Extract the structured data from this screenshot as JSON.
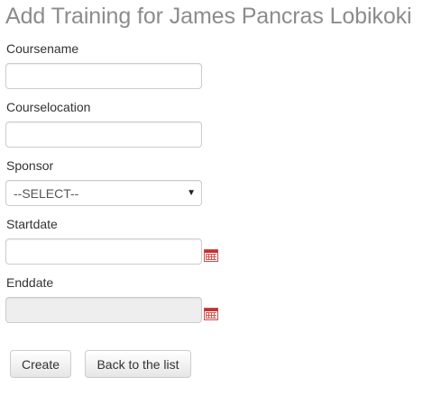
{
  "page": {
    "title": "Add Training for James Pancras Lobikoki"
  },
  "form": {
    "coursename": {
      "label": "Coursename",
      "value": ""
    },
    "courselocation": {
      "label": "Courselocation",
      "value": ""
    },
    "sponsor": {
      "label": "Sponsor",
      "selected": "--SELECT--"
    },
    "startdate": {
      "label": "Startdate",
      "value": "",
      "icon": "calendar-icon"
    },
    "enddate": {
      "label": "Enddate",
      "value": "",
      "disabled": true,
      "icon": "calendar-icon"
    }
  },
  "actions": {
    "create_label": "Create",
    "back_label": "Back to the list"
  },
  "colors": {
    "title": "#8c8c8c",
    "calendar_icon": "#c9302c",
    "disabled_field": "#eeeeee"
  }
}
